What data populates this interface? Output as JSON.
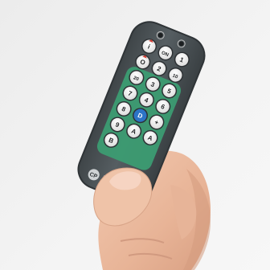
{
  "image": {
    "subject": "handheld infrared remote control with numbered round buttons",
    "colors": {
      "background": "#f2f2f2",
      "remote_body": "#4d5458",
      "remote_edge": "#353a3d",
      "panel_green": "#3c9c72",
      "button_face": "#f7f7f7",
      "button_ring": "#2d3134",
      "skin": "#ecbfa4",
      "skin_shadow": "#cf9a80",
      "accent_red": "#d33a30",
      "accent_blue": "#2c74c6"
    }
  },
  "remote": {
    "buttons": [
      {
        "label": "i",
        "style": "red-arrow"
      },
      {
        "label": "ON",
        "style": "plain"
      },
      {
        "label": "1",
        "style": "plain"
      },
      {
        "label": "O",
        "style": "red-arrow"
      },
      {
        "label": "2",
        "style": "plain"
      },
      {
        "label": "10",
        "style": "plain"
      },
      {
        "label": "20",
        "style": "plain"
      },
      {
        "label": "3",
        "style": "plain"
      },
      {
        "label": "5",
        "style": "plain"
      },
      {
        "label": "7",
        "style": "plain"
      },
      {
        "label": "4",
        "style": "plain"
      },
      {
        "label": "6",
        "style": "plain"
      },
      {
        "label": "8",
        "style": "plain"
      },
      {
        "label": "D",
        "style": "blue-fill"
      },
      {
        "label": "+",
        "style": "plain"
      },
      {
        "label": "9",
        "style": "plain"
      },
      {
        "label": "A",
        "style": "plain"
      },
      {
        "label": "A",
        "style": "plain"
      },
      {
        "label": "B",
        "style": "plain"
      }
    ],
    "brand_mark": "CP"
  }
}
